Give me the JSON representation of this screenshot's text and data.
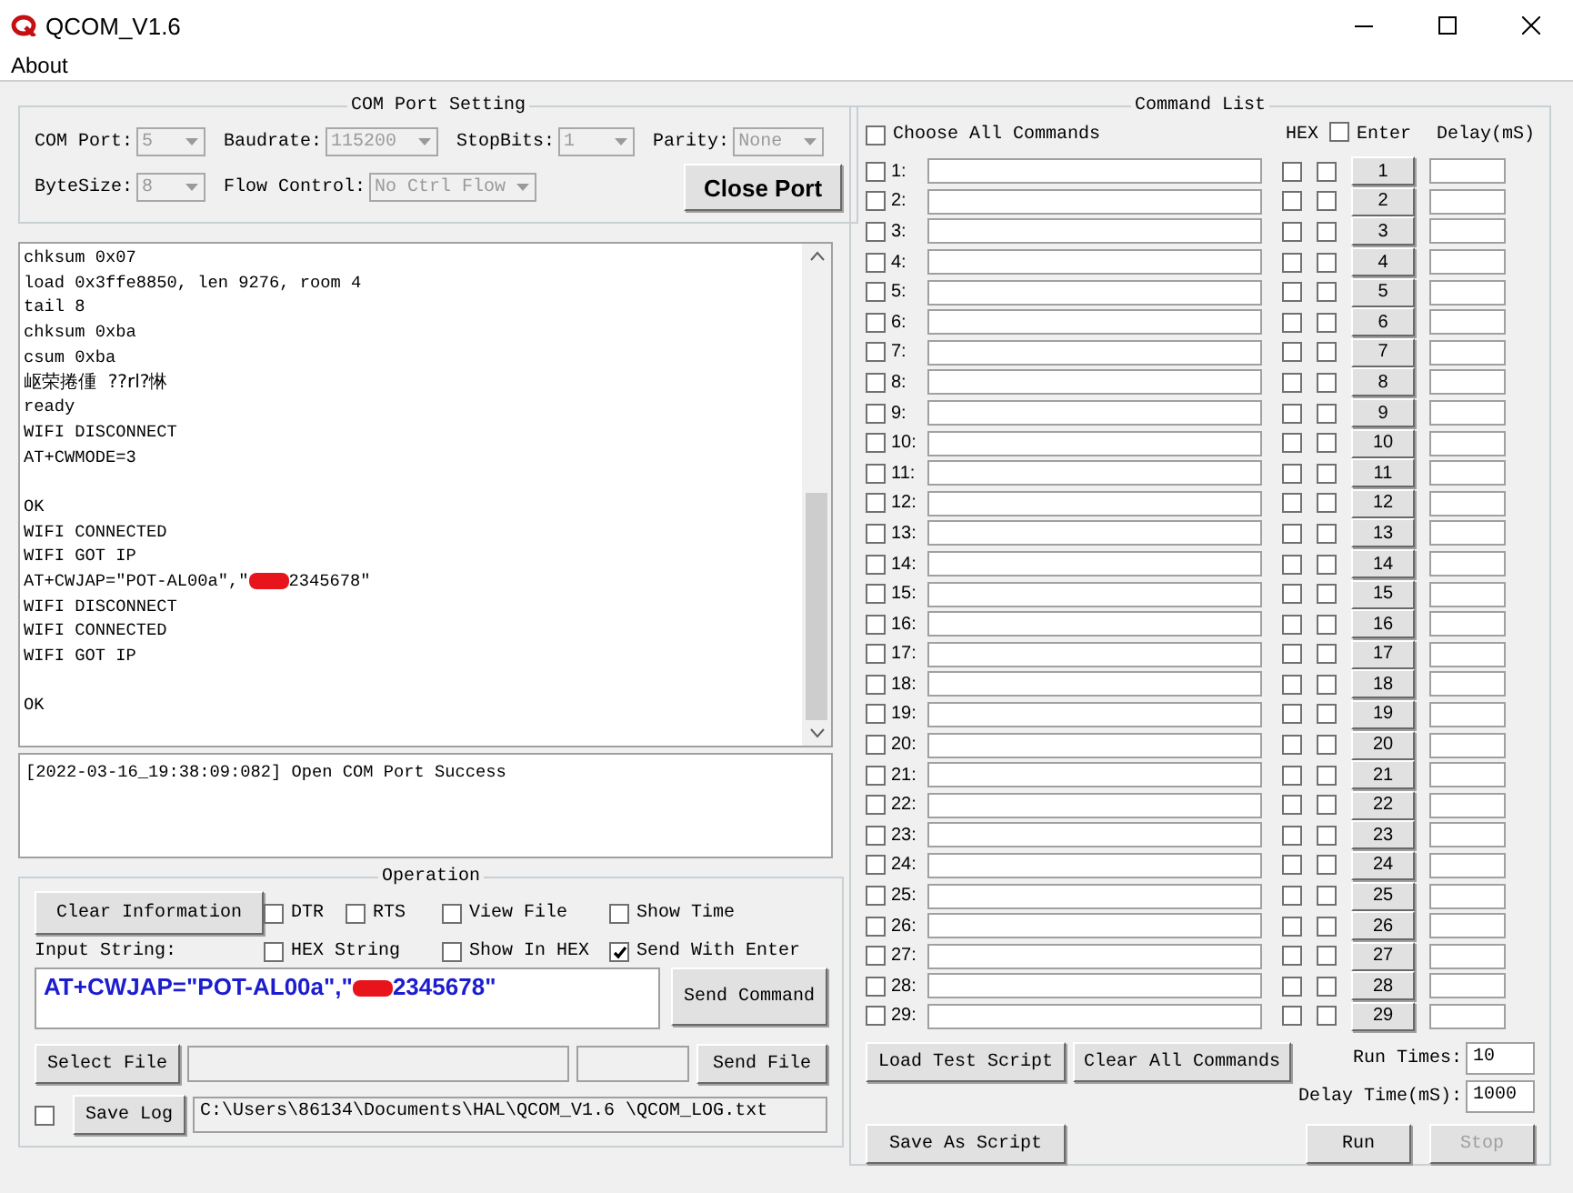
{
  "window": {
    "title": "QCOM_V1.6"
  },
  "menu": [
    "About"
  ],
  "com_port_setting": {
    "title": "COM Port Setting",
    "fields": [
      {
        "label": "COM Port:",
        "value": "5",
        "disabled": true
      },
      {
        "label": "Baudrate:",
        "value": "115200",
        "disabled": true
      },
      {
        "label": "StopBits:",
        "value": "1",
        "disabled": true
      },
      {
        "label": "Parity:",
        "value": "None",
        "disabled": true
      },
      {
        "label": "ByteSize:",
        "value": "8",
        "disabled": true
      },
      {
        "label": "Flow Control:",
        "value": "No Ctrl Flow",
        "disabled": true
      }
    ],
    "button": "Close Port"
  },
  "receive_log": [
    {
      "kind": "text",
      "text": "chksum 0x07"
    },
    {
      "kind": "text",
      "text": "load 0x3ffe8850, len 9276, room 4"
    },
    {
      "kind": "text",
      "text": "tail 8"
    },
    {
      "kind": "text",
      "text": "chksum 0xba"
    },
    {
      "kind": "text",
      "text": "csum 0xba"
    },
    {
      "kind": "text",
      "text": "岖荣捲偅  ??rl?惏"
    },
    {
      "kind": "text",
      "text": "ready"
    },
    {
      "kind": "text",
      "text": "WIFI DISCONNECT"
    },
    {
      "kind": "text",
      "text": "AT+CWMODE=3"
    },
    {
      "kind": "blank"
    },
    {
      "kind": "text",
      "text": "OK"
    },
    {
      "kind": "text",
      "text": "WIFI CONNECTED"
    },
    {
      "kind": "text",
      "text": "WIFI GOT IP"
    },
    {
      "kind": "redacted",
      "before": "AT+CWJAP=\"POT-AL00a\",\"",
      "after": "2345678\""
    },
    {
      "kind": "text",
      "text": "WIFI DISCONNECT"
    },
    {
      "kind": "text",
      "text": "WIFI CONNECTED"
    },
    {
      "kind": "text",
      "text": "WIFI GOT IP"
    },
    {
      "kind": "blank"
    },
    {
      "kind": "text",
      "text": "OK"
    }
  ],
  "status_log": [
    "[2022-03-16_19:38:09:082] Open COM Port Success"
  ],
  "operation": {
    "title": "Operation",
    "clear_button": "Clear Information",
    "options": [
      {
        "label": "DTR",
        "checked": false
      },
      {
        "label": "RTS",
        "checked": false
      },
      {
        "label": "View File",
        "checked": false
      },
      {
        "label": "Show Time",
        "checked": false
      },
      {
        "label": "HEX String",
        "checked": false
      },
      {
        "label": "Show In HEX",
        "checked": false
      },
      {
        "label": "Send With Enter",
        "checked": true
      }
    ],
    "input_label": "Input String:",
    "input_value": {
      "before": "AT+CWJAP=\"POT-AL00a\",\"",
      "after": "2345678\""
    },
    "send_button": "Send Command",
    "select_file_button": "Select File",
    "send_file_button": "Send File",
    "save_log": {
      "checked": false,
      "button": "Save Log",
      "path": "C:\\Users\\86134\\Documents\\HAL\\QCOM_V1.6 \\QCOM_LOG.txt"
    }
  },
  "command_list": {
    "title": "Command List",
    "choose_all": {
      "label": "Choose All Commands",
      "checked": false
    },
    "hex_header": "HEX",
    "enter_header": {
      "label": "Enter",
      "checked": false
    },
    "delay_header": "Delay(mS)",
    "rows": [
      {
        "label": "1:",
        "button": "1",
        "checked": false,
        "hex": false,
        "enter": false
      },
      {
        "label": "2:",
        "button": "2",
        "checked": false,
        "hex": false,
        "enter": false
      },
      {
        "label": "3:",
        "button": "3",
        "checked": false,
        "hex": false,
        "enter": false
      },
      {
        "label": "4:",
        "button": "4",
        "checked": false,
        "hex": false,
        "enter": false
      },
      {
        "label": "5:",
        "button": "5",
        "checked": false,
        "hex": false,
        "enter": false
      },
      {
        "label": "6:",
        "button": "6",
        "checked": false,
        "hex": false,
        "enter": false
      },
      {
        "label": "7:",
        "button": "7",
        "checked": false,
        "hex": false,
        "enter": false
      },
      {
        "label": "8:",
        "button": "8",
        "checked": false,
        "hex": false,
        "enter": false
      },
      {
        "label": "9:",
        "button": "9",
        "checked": false,
        "hex": false,
        "enter": false
      },
      {
        "label": "10:",
        "button": "10",
        "checked": false,
        "hex": false,
        "enter": false
      },
      {
        "label": "11:",
        "button": "11",
        "checked": false,
        "hex": false,
        "enter": false
      },
      {
        "label": "12:",
        "button": "12",
        "checked": false,
        "hex": false,
        "enter": false
      },
      {
        "label": "13:",
        "button": "13",
        "checked": false,
        "hex": false,
        "enter": false
      },
      {
        "label": "14:",
        "button": "14",
        "checked": false,
        "hex": false,
        "enter": false
      },
      {
        "label": "15:",
        "button": "15",
        "checked": false,
        "hex": false,
        "enter": false
      },
      {
        "label": "16:",
        "button": "16",
        "checked": false,
        "hex": false,
        "enter": false
      },
      {
        "label": "17:",
        "button": "17",
        "checked": false,
        "hex": false,
        "enter": false
      },
      {
        "label": "18:",
        "button": "18",
        "checked": false,
        "hex": false,
        "enter": false
      },
      {
        "label": "19:",
        "button": "19",
        "checked": false,
        "hex": false,
        "enter": false
      },
      {
        "label": "20:",
        "button": "20",
        "checked": false,
        "hex": false,
        "enter": false
      },
      {
        "label": "21:",
        "button": "21",
        "checked": false,
        "hex": false,
        "enter": false
      },
      {
        "label": "22:",
        "button": "22",
        "checked": false,
        "hex": false,
        "enter": false
      },
      {
        "label": "23:",
        "button": "23",
        "checked": false,
        "hex": false,
        "enter": false
      },
      {
        "label": "24:",
        "button": "24",
        "checked": false,
        "hex": false,
        "enter": false
      },
      {
        "label": "25:",
        "button": "25",
        "checked": false,
        "hex": false,
        "enter": false
      },
      {
        "label": "26:",
        "button": "26",
        "checked": false,
        "hex": false,
        "enter": false
      },
      {
        "label": "27:",
        "button": "27",
        "checked": false,
        "hex": false,
        "enter": false
      },
      {
        "label": "28:",
        "button": "28",
        "checked": false,
        "hex": false,
        "enter": false
      },
      {
        "label": "29:",
        "button": "29",
        "checked": false,
        "hex": false,
        "enter": false
      }
    ],
    "load_button": "Load Test Script",
    "clear_button": "Clear All Commands",
    "save_button": "Save As Script",
    "run_times": {
      "label": "Run Times:",
      "value": "10"
    },
    "delay_time": {
      "label": "Delay Time(mS):",
      "value": "1000"
    },
    "run_button": {
      "label": "Run",
      "disabled": false
    },
    "stop_button": {
      "label": "Stop",
      "disabled": true
    }
  }
}
